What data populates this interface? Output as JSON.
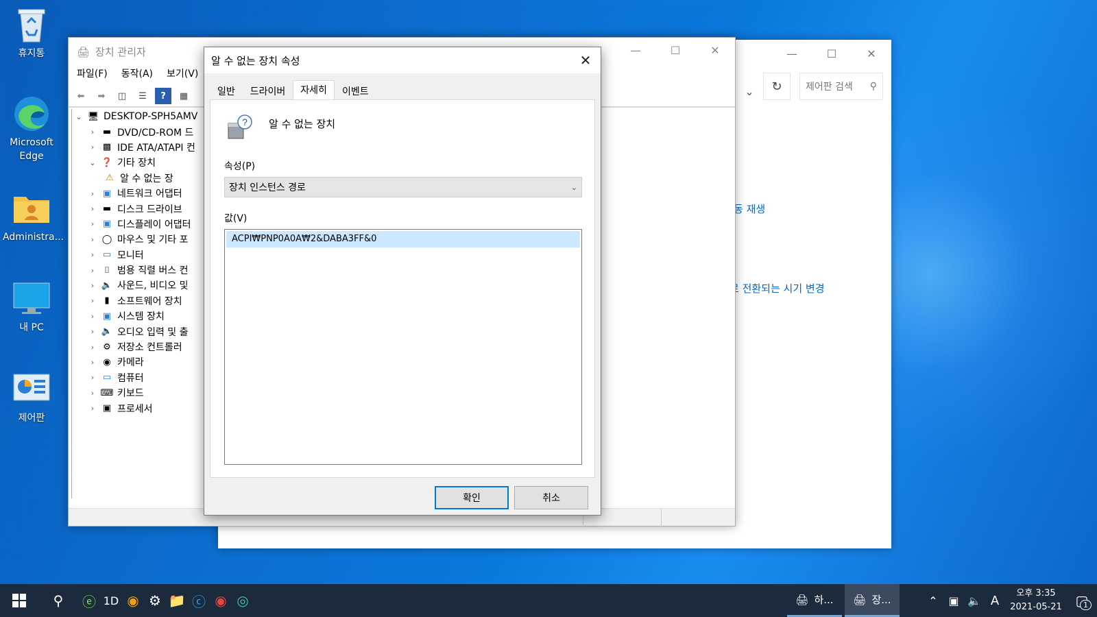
{
  "desktop": {
    "icons": [
      {
        "label": "휴지통",
        "icon": "recycle-bin-icon"
      },
      {
        "label": "Microsoft Edge",
        "icon": "edge-icon"
      },
      {
        "label": "Administra...",
        "icon": "user-folder-icon"
      },
      {
        "label": "내 PC",
        "icon": "this-pc-icon"
      },
      {
        "label": "제어판",
        "icon": "control-panel-icon"
      }
    ]
  },
  "control_panel": {
    "search_placeholder": "제어판 검색",
    "link1": "동 재생",
    "link2": "로 전환되는 시기 변경"
  },
  "device_manager": {
    "title": "장치 관리자",
    "menu": [
      "파일(F)",
      "동작(A)",
      "보기(V)"
    ],
    "tree": {
      "root": "DESKTOP-SPH5AMV",
      "items": [
        {
          "label": "DVD/CD-ROM 드",
          "expanded": false
        },
        {
          "label": "IDE ATA/ATAPI 컨",
          "expanded": false
        },
        {
          "label": "기타 장치",
          "expanded": true
        },
        {
          "label": "알 수 없는 장",
          "child": true
        },
        {
          "label": "네트워크 어댑터",
          "expanded": false
        },
        {
          "label": "디스크 드라이브",
          "expanded": false
        },
        {
          "label": "디스플레이 어댑터",
          "expanded": false
        },
        {
          "label": "마우스 및 기타 포",
          "expanded": false
        },
        {
          "label": "모니터",
          "expanded": false
        },
        {
          "label": "범용 직렬 버스 컨",
          "expanded": false
        },
        {
          "label": "사운드, 비디오 및",
          "expanded": false
        },
        {
          "label": "소프트웨어 장치",
          "expanded": false
        },
        {
          "label": "시스템 장치",
          "expanded": false
        },
        {
          "label": "오디오 입력 및 출",
          "expanded": false
        },
        {
          "label": "저장소 컨트롤러",
          "expanded": false
        },
        {
          "label": "카메라",
          "expanded": false
        },
        {
          "label": "컴퓨터",
          "expanded": false
        },
        {
          "label": "키보드",
          "expanded": false
        },
        {
          "label": "프로세서",
          "expanded": false
        }
      ]
    }
  },
  "dialog": {
    "title": "알 수 없는 장치 속성",
    "tabs": [
      "일반",
      "드라이버",
      "자세히",
      "이벤트"
    ],
    "active_tab": "자세히",
    "device_name": "알 수 없는 장치",
    "property_label": "속성(P)",
    "property_value": "장치 인스턴스 경로",
    "value_label": "값(V)",
    "values": [
      "ACPI₩PNP0A0A₩2&DABA3FF&0"
    ],
    "ok": "확인",
    "cancel": "취소"
  },
  "taskbar": {
    "tasks": [
      {
        "label": "하..."
      },
      {
        "label": "장..."
      }
    ],
    "ime": "A",
    "time": "오후 3:35",
    "date": "2021-05-21",
    "notification_count": "1"
  }
}
